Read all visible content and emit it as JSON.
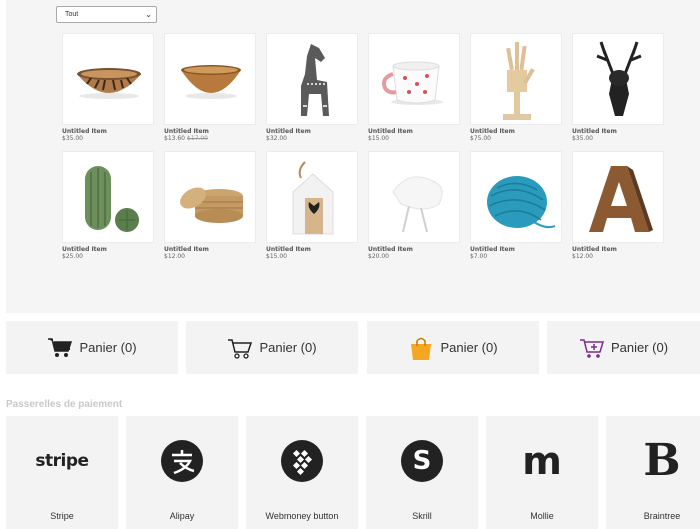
{
  "filter": {
    "selected": "Tout"
  },
  "products": [
    {
      "name": "Untitled Item",
      "price": "$35.00",
      "old_price": "",
      "image": "bowl-striped"
    },
    {
      "name": "Untitled Item",
      "price": "$13.60",
      "old_price": "$17.00",
      "image": "bowl-wood"
    },
    {
      "name": "Untitled Item",
      "price": "$32.00",
      "old_price": "",
      "image": "horse"
    },
    {
      "name": "Untitled Item",
      "price": "$15.00",
      "old_price": "",
      "image": "mug"
    },
    {
      "name": "Untitled Item",
      "price": "$75.00",
      "old_price": "",
      "image": "wooden-hand"
    },
    {
      "name": "Untitled Item",
      "price": "$35.00",
      "old_price": "",
      "image": "deer-head"
    },
    {
      "name": "Untitled Item",
      "price": "$25.00",
      "old_price": "",
      "image": "cactus"
    },
    {
      "name": "Untitled Item",
      "price": "$12.00",
      "old_price": "",
      "image": "basket"
    },
    {
      "name": "Untitled Item",
      "price": "$15.00",
      "old_price": "",
      "image": "birdhouse"
    },
    {
      "name": "Untitled Item",
      "price": "$20.00",
      "old_price": "",
      "image": "bird"
    },
    {
      "name": "Untitled Item",
      "price": "$7.00",
      "old_price": "",
      "image": "yarn"
    },
    {
      "name": "Untitled Item",
      "price": "$12.00",
      "old_price": "",
      "image": "letter-a"
    }
  ],
  "carts": [
    {
      "label": "Panier (0)",
      "icon": "cart-black-icon"
    },
    {
      "label": "Panier (0)",
      "icon": "cart-outline-icon"
    },
    {
      "label": "Panier (0)",
      "icon": "shopping-bag-icon"
    },
    {
      "label": "Panier (0)",
      "icon": "cart-add-icon"
    }
  ],
  "gateways": {
    "title": "Passerelles de paiement",
    "items": [
      {
        "name": "Stripe",
        "logo_text": "stripe",
        "icon": "stripe-logo"
      },
      {
        "name": "Alipay",
        "icon": "alipay-logo"
      },
      {
        "name": "Webmoney button",
        "icon": "webmoney-logo"
      },
      {
        "name": "Skrill",
        "logo_text": "S",
        "icon": "skrill-logo"
      },
      {
        "name": "Mollie",
        "logo_text": "m",
        "icon": "mollie-logo"
      },
      {
        "name": "Braintree",
        "logo_text": "B",
        "icon": "braintree-logo"
      }
    ]
  },
  "colors": {
    "bag_orange": "#f5a623",
    "cart_add_purple": "#7b2d8e",
    "yarn_blue": "#2a9bbd"
  }
}
